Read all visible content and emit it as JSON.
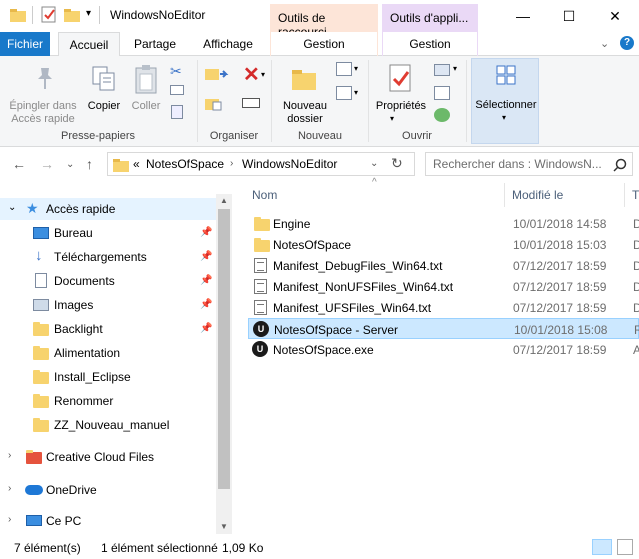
{
  "window": {
    "title": "WindowsNoEditor",
    "controls": {
      "minimize": "—",
      "maximize": "☐",
      "close": "✕"
    },
    "help": "?"
  },
  "context_tabs": [
    {
      "title": "Outils de raccourci",
      "tab": "Gestion",
      "color": "#fce4d6",
      "bg": "#fde5d8"
    },
    {
      "title": "Outils d'appli...",
      "tab": "Gestion",
      "color": "#e8d9f3",
      "bg": "#ead9f6"
    }
  ],
  "ribbon_tabs": [
    {
      "label": "Fichier",
      "active": false,
      "primary": true
    },
    {
      "label": "Accueil",
      "active": true
    },
    {
      "label": "Partage",
      "active": false
    },
    {
      "label": "Affichage",
      "active": false
    }
  ],
  "ribbon": {
    "pin_label": "Épingler dans\nAccès rapide",
    "copy_label": "Copier",
    "paste_label": "Coller",
    "group_clipboard": "Presse-papiers",
    "group_organize": "Organiser",
    "new_folder_label": "Nouveau\ndossier",
    "group_new": "Nouveau",
    "properties_label": "Propriétés",
    "group_open": "Ouvrir",
    "select_label": "Sélectionner"
  },
  "address": {
    "overflow": "«",
    "crumbs": [
      "NotesOfSpace",
      "WindowsNoEditor"
    ],
    "search_placeholder": "Rechercher dans : WindowsN..."
  },
  "nav_pane": {
    "quick_access": "Accès rapide",
    "items": [
      {
        "label": "Bureau",
        "icon": "desktop-icon",
        "pinned": true
      },
      {
        "label": "Téléchargements",
        "icon": "download-icon",
        "pinned": true
      },
      {
        "label": "Documents",
        "icon": "documents-icon",
        "pinned": true
      },
      {
        "label": "Images",
        "icon": "images-icon",
        "pinned": true
      },
      {
        "label": "Backlight",
        "icon": "folder-icon",
        "pinned": true
      },
      {
        "label": "Alimentation",
        "icon": "folder-icon",
        "pinned": false
      },
      {
        "label": "Install_Eclipse",
        "icon": "folder-icon",
        "pinned": false
      },
      {
        "label": "Renommer",
        "icon": "folder-icon",
        "pinned": false
      },
      {
        "label": "ZZ_Nouveau_manuel",
        "icon": "folder-icon",
        "pinned": false
      }
    ],
    "roots": [
      {
        "label": "Creative Cloud Files",
        "icon": "creative-cloud-icon"
      },
      {
        "label": "OneDrive",
        "icon": "onedrive-icon"
      },
      {
        "label": "Ce PC",
        "icon": "pc-icon"
      }
    ]
  },
  "file_list": {
    "columns": {
      "name": "Nom",
      "modified": "Modifié le",
      "type": "T"
    },
    "rows": [
      {
        "name": "Engine",
        "modified": "10/01/2018 14:58",
        "type": "D",
        "icon": "folder-icon",
        "selected": false
      },
      {
        "name": "NotesOfSpace",
        "modified": "10/01/2018 15:03",
        "type": "D",
        "icon": "folder-icon",
        "selected": false
      },
      {
        "name": "Manifest_DebugFiles_Win64.txt",
        "modified": "07/12/2017 18:59",
        "type": "D",
        "icon": "text-file-icon",
        "selected": false
      },
      {
        "name": "Manifest_NonUFSFiles_Win64.txt",
        "modified": "07/12/2017 18:59",
        "type": "D",
        "icon": "text-file-icon",
        "selected": false
      },
      {
        "name": "Manifest_UFSFiles_Win64.txt",
        "modified": "07/12/2017 18:59",
        "type": "D",
        "icon": "text-file-icon",
        "selected": false
      },
      {
        "name": "NotesOfSpace - Server",
        "modified": "10/01/2018 15:08",
        "type": "R",
        "icon": "unreal-shortcut-icon",
        "selected": true
      },
      {
        "name": "NotesOfSpace.exe",
        "modified": "07/12/2017 18:59",
        "type": "A",
        "icon": "unreal-icon",
        "selected": false
      }
    ]
  },
  "status": {
    "count": "7 élément(s)",
    "selection": "1 élément sélectionné",
    "size": "1,09 Ko"
  }
}
